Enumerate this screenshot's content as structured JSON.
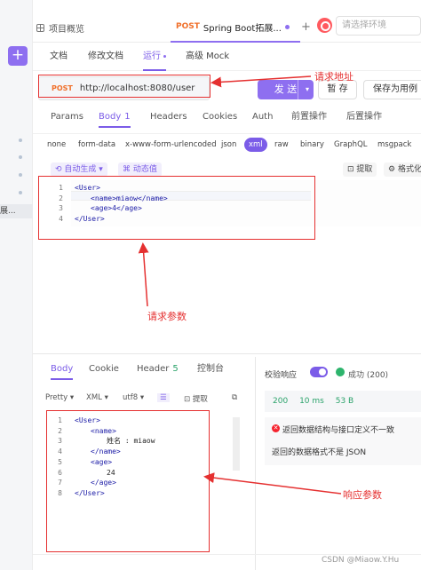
{
  "tabs": {
    "overview_label": "项目概览",
    "active_method": "POST",
    "active_title": "Spring Boot拓展...",
    "plus_label": "+",
    "env_placeholder": "请选择环境"
  },
  "sub_tabs": [
    "文档",
    "修改文档",
    "运行",
    "高级 Mock"
  ],
  "rail_label": "展...",
  "url_bar": {
    "method": "POST",
    "url": "http://localhost:8080/user",
    "send_label": "发 送",
    "save_label": "暂 存",
    "save_as_label": "保存为用例"
  },
  "request_tabs": [
    {
      "label": "Params",
      "count": ""
    },
    {
      "label": "Body",
      "count": "1"
    },
    {
      "label": "Headers",
      "count": ""
    },
    {
      "label": "Cookies",
      "count": ""
    },
    {
      "label": "Auth",
      "count": ""
    },
    {
      "label": "前置操作",
      "count": ""
    },
    {
      "label": "后置操作",
      "count": ""
    }
  ],
  "body_types": [
    "none",
    "form-data",
    "x-www-form-urlencoded",
    "json",
    "xml",
    "raw",
    "binary",
    "GraphQL",
    "msgpack"
  ],
  "body_tools": {
    "auto_generate": "自动生成",
    "dynamic_value": "动态值",
    "extract": "提取",
    "format": "格式化"
  },
  "request_code": [
    {
      "ln": "1",
      "indent": 0,
      "text": "<User>"
    },
    {
      "ln": "2",
      "indent": 1,
      "text": "<name>miaow</name>"
    },
    {
      "ln": "3",
      "indent": 1,
      "text": "<age>4</age>"
    },
    {
      "ln": "4",
      "indent": 0,
      "text": "</User>"
    }
  ],
  "response_tabs": [
    {
      "label": "Body",
      "count": ""
    },
    {
      "label": "Cookie",
      "count": ""
    },
    {
      "label": "Header",
      "count": "5"
    },
    {
      "label": "控制台",
      "count": ""
    }
  ],
  "response_toolbar": {
    "pretty": "Pretty",
    "format": "XML",
    "encoding": "utf8",
    "extract": "提取"
  },
  "response_code": [
    {
      "ln": "1",
      "indent": 0,
      "text": "<User>"
    },
    {
      "ln": "2",
      "indent": 1,
      "text": "<name>"
    },
    {
      "ln": "3",
      "indent": 2,
      "text": "姓名 : miaow"
    },
    {
      "ln": "4",
      "indent": 1,
      "text": "</name>"
    },
    {
      "ln": "5",
      "indent": 1,
      "text": "<age>"
    },
    {
      "ln": "6",
      "indent": 2,
      "text": "24"
    },
    {
      "ln": "7",
      "indent": 1,
      "text": "</age>"
    },
    {
      "ln": "8",
      "indent": 0,
      "text": "</User>"
    }
  ],
  "validation": {
    "label": "校验响应",
    "success": "成功 (200)",
    "status_code": "200",
    "time": "10 ms",
    "size": "53 B",
    "error_title": "返回数据结构与接口定义不一致",
    "error_detail": "返回的数据格式不是 JSON"
  },
  "annotations": {
    "url_note": "请求地址",
    "request_note": "请求参数",
    "response_note": "响应参数"
  },
  "watermark": "CSDN @Miaow.Y.Hu",
  "colors": {
    "accent": "#7b5ce8",
    "annotation": "#e53030",
    "post_method": "#f0702b",
    "success": "#2db46c",
    "error": "#f5222d"
  }
}
